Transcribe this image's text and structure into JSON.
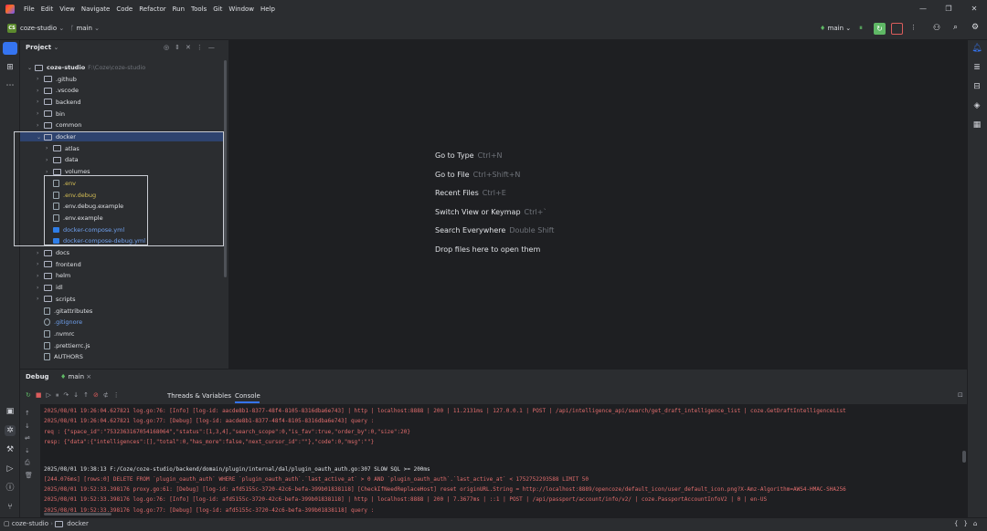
{
  "menu": [
    "File",
    "Edit",
    "View",
    "Navigate",
    "Code",
    "Refactor",
    "Run",
    "Tools",
    "Git",
    "Window",
    "Help"
  ],
  "toolbar": {
    "project_badge": "CS",
    "project": "coze-studio",
    "branch": "main",
    "run_branch": "main"
  },
  "project_panel": {
    "title": "Project",
    "root_name": "coze-studio",
    "root_path": "F:\\Coze\\coze-studio",
    "items": [
      {
        "label": ".github",
        "kind": "folder",
        "depth": 1
      },
      {
        "label": ".vscode",
        "kind": "folder",
        "depth": 1
      },
      {
        "label": "backend",
        "kind": "folder",
        "depth": 1
      },
      {
        "label": "bin",
        "kind": "folder",
        "depth": 1
      },
      {
        "label": "common",
        "kind": "folder",
        "depth": 1
      },
      {
        "label": "docker",
        "kind": "folder",
        "depth": 1,
        "open": true,
        "selected": true
      },
      {
        "label": "atlas",
        "kind": "folder",
        "depth": 2
      },
      {
        "label": "data",
        "kind": "folder",
        "depth": 2
      },
      {
        "label": "volumes",
        "kind": "folder",
        "depth": 2
      },
      {
        "label": ".env",
        "kind": "file",
        "depth": 2,
        "color": "#d6bf55"
      },
      {
        "label": ".env.debug",
        "kind": "file",
        "depth": 2,
        "color": "#d6bf55"
      },
      {
        "label": ".env.debug.example",
        "kind": "file",
        "depth": 2
      },
      {
        "label": ".env.example",
        "kind": "file",
        "depth": 2
      },
      {
        "label": "docker-compose.yml",
        "kind": "docker",
        "depth": 2,
        "color": "#6fa0ee"
      },
      {
        "label": "docker-compose-debug.yml",
        "kind": "docker",
        "depth": 2,
        "color": "#6fa0ee"
      },
      {
        "label": "docs",
        "kind": "folder",
        "depth": 1
      },
      {
        "label": "frontend",
        "kind": "folder",
        "depth": 1
      },
      {
        "label": "helm",
        "kind": "folder",
        "depth": 1
      },
      {
        "label": "idl",
        "kind": "folder",
        "depth": 1
      },
      {
        "label": "scripts",
        "kind": "folder",
        "depth": 1
      },
      {
        "label": ".gitattributes",
        "kind": "file",
        "depth": 1
      },
      {
        "label": ".gitignore",
        "kind": "ignore",
        "depth": 1,
        "color": "#6fa0ee"
      },
      {
        "label": ".nvmrc",
        "kind": "file",
        "depth": 1
      },
      {
        "label": ".prettierrc.js",
        "kind": "file",
        "depth": 1
      },
      {
        "label": "AUTHORS",
        "kind": "file",
        "depth": 1
      }
    ]
  },
  "editor_hints": [
    {
      "label": "Go to Type",
      "shortcut": "Ctrl+N"
    },
    {
      "label": "Go to File",
      "shortcut": "Ctrl+Shift+N"
    },
    {
      "label": "Recent Files",
      "shortcut": "Ctrl+E"
    },
    {
      "label": "Switch View or Keymap",
      "shortcut": "Ctrl+`"
    },
    {
      "label": "Search Everywhere",
      "shortcut": "Double Shift"
    },
    {
      "label": "Drop files here to open them",
      "shortcut": ""
    }
  ],
  "debug": {
    "title": "Debug",
    "session": "main",
    "tabs": [
      "Threads & Variables",
      "Console"
    ],
    "active_tab": "Console",
    "lines": [
      {
        "text": "2025/08/01 19:26:04.627821 log.go:76: [Info] [log-id: aacde8b1-8377-48f4-8105-8316dba6e743] | http | localhost:8888 | 200 | 11.2131ms | 127.0.0.1 | POST | /api/intelligence_api/search/get_draft_intelligence_list | coze.GetDraftIntelligenceList",
        "color": "#e06c6c"
      },
      {
        "text": "2025/08/01 19:26:04.627821 log.go:77: [Debug] [log-id: aacde8b1-8377-48f4-8105-8316dba6e743] query :",
        "color": "#e06c6c"
      },
      {
        "text": "req : {\"space_id\":\"7532363167054168064\",\"status\":[1,3,4],\"search_scope\":0,\"is_fav\":true,\"order_by\":0,\"size\":20}",
        "color": "#e06c6c"
      },
      {
        "text": "resp: {\"data\":{\"intelligences\":[],\"total\":0,\"has_more\":false,\"next_cursor_id\":\"\"},\"code\":0,\"msg\":\"\"}",
        "color": "#e06c6c"
      },
      {
        "text": "",
        "color": "#dfe1e5"
      },
      {
        "text": "2025/08/01 19:38:13 F:/Coze/coze-studio/backend/domain/plugin/internal/dal/plugin_oauth_auth.go:307 SLOW SQL >= 200ms",
        "color": "#dfe1e5"
      },
      {
        "text": "[244.076ms] [rows:0] DELETE FROM `plugin_oauth_auth` WHERE `plugin_oauth_auth`.`last_active_at` > 0 AND `plugin_oauth_auth`.`last_active_at` < 1752752293588 LIMIT 50",
        "color": "#e06c6c"
      },
      {
        "text": "2025/08/01 19:52:33.398176 proxy.go:61: [Debug] [log-id: afd5155c-3720-42c6-befa-399b01838118] [CheckIfNeedReplaceHost] reset originURL.String = http://localhost:8889/opencoze/default_icon/user_default_icon.png?X-Amz-Algorithm=AWS4-HMAC-SHA256",
        "color": "#e06c6c"
      },
      {
        "text": "2025/08/01 19:52:33.398176 log.go:76: [Info] [log-id: afd5155c-3720-42c6-befa-399b01838118] | http | localhost:8888 | 200 | 7.3677ms | ::1 | POST | /api/passport/account/info/v2/ | coze.PassportAccountInfoV2 | 0 | en-US",
        "color": "#e06c6c"
      },
      {
        "text": "2025/08/01 19:52:33.398176 log.go:77: [Debug] [log-id: afd5155c-3720-42c6-befa-399b01838118] query :",
        "color": "#e06c6c"
      }
    ]
  },
  "status": {
    "project": "coze-studio",
    "folder": "docker"
  },
  "colors": {
    "accent": "#3574f0",
    "selection": "#2e436e",
    "run_green": "#5fb865",
    "stop_red": "#db5c5c"
  }
}
